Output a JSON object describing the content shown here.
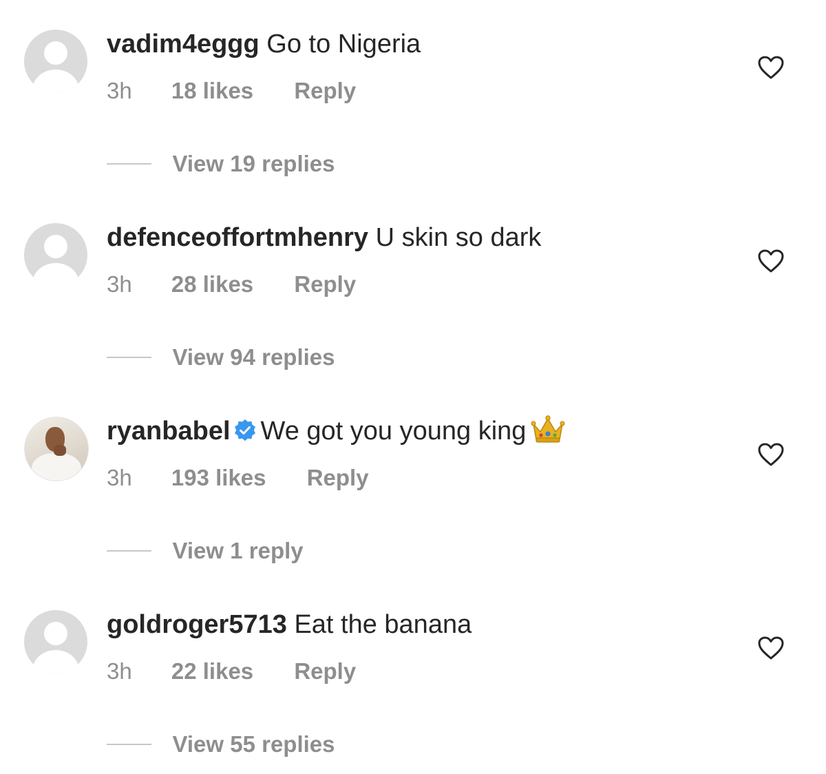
{
  "comments": [
    {
      "username": "vadim4eggg",
      "text": "Go to Nigeria",
      "time": "3h",
      "likes": "18 likes",
      "reply_label": "Reply",
      "view_replies": "View 19 replies",
      "verified": false,
      "avatar": "default-avatar"
    },
    {
      "username": "defenceoffortmhenry",
      "text": "U skin so dark",
      "time": "3h",
      "likes": "28 likes",
      "reply_label": "Reply",
      "view_replies": "View 94 replies",
      "verified": false,
      "avatar": "default-avatar"
    },
    {
      "username": "ryanbabel",
      "text": "We got you young king",
      "emoji": "crown",
      "time": "3h",
      "likes": "193 likes",
      "reply_label": "Reply",
      "view_replies": "View 1 reply",
      "verified": true,
      "avatar": "profile-photo"
    },
    {
      "username": "goldroger5713",
      "text": "Eat the banana",
      "time": "3h",
      "likes": "22 likes",
      "reply_label": "Reply",
      "view_replies": "View 55 replies",
      "verified": false,
      "avatar": "default-avatar"
    }
  ],
  "colors": {
    "primary_text": "#262626",
    "secondary_text": "#8e8e8e",
    "verified_blue": "#3897f0",
    "avatar_placeholder": "#dbdbdb",
    "divider": "#c7c7c7"
  },
  "icons": {
    "like": "heart-outline-icon",
    "verified": "verified-badge-icon"
  }
}
